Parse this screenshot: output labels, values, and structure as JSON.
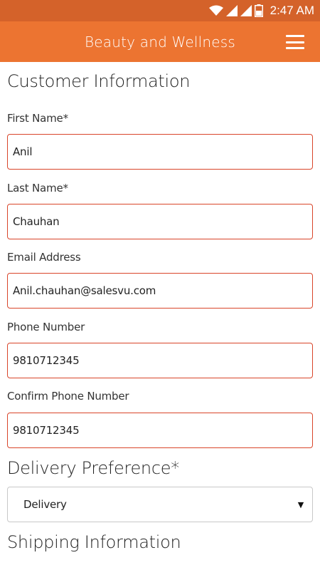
{
  "statusbar": {
    "time": "2:47 AM",
    "icons": [
      "wifi-icon",
      "signal-icon",
      "signal-icon",
      "battery-icon"
    ]
  },
  "appbar": {
    "title": "Beauty and Wellness",
    "menu_icon": "hamburger-menu-icon"
  },
  "customer": {
    "title": "Customer Information",
    "first_name": {
      "label": "First Name*",
      "value": "Anil"
    },
    "last_name": {
      "label": "Last Name*",
      "value": "Chauhan"
    },
    "email": {
      "label": "Email Address",
      "value": "Anil.chauhan@salesvu.com"
    },
    "phone": {
      "label": "Phone Number",
      "value": "9810712345"
    },
    "confirm_phone": {
      "label": "Confirm Phone Number",
      "value": "9810712345"
    }
  },
  "delivery": {
    "title": "Delivery Preference*",
    "selected": "Delivery"
  },
  "shipping": {
    "title": "Shipping Information"
  },
  "colors": {
    "statusbar": "#d4622a",
    "appbar": "#ec7431",
    "field_border": "#d9452a"
  }
}
